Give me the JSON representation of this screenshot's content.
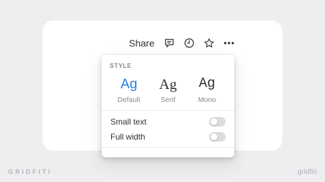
{
  "toolbar": {
    "share_label": "Share",
    "icons": [
      "comment-icon",
      "clock-icon",
      "star-icon",
      "more-icon"
    ]
  },
  "style_menu": {
    "section_label": "STYLE",
    "options": [
      {
        "glyph": "Ag",
        "name": "Default",
        "selected": true
      },
      {
        "glyph": "Ag",
        "name": "Serif",
        "selected": false
      },
      {
        "glyph": "Ag",
        "name": "Mono",
        "selected": false
      }
    ],
    "toggles": [
      {
        "label": "Small text",
        "on": false
      },
      {
        "label": "Full width",
        "on": false
      }
    ]
  },
  "colors": {
    "accent": "#2383e2",
    "background": "#eeeef0",
    "toggle_off": "#dcdcda"
  },
  "brand": {
    "left_text": "GRIDFITI",
    "right_text": "gridfiti"
  }
}
